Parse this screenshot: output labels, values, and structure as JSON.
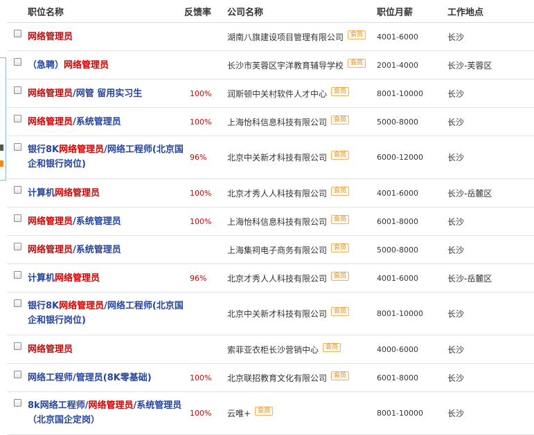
{
  "header": {
    "title": "职位名称",
    "feedback": "反馈率",
    "company": "公司名称",
    "salary": "职位月薪",
    "location": "工作地点"
  },
  "badge_label": "会员",
  "colors": {
    "keyword": "#d40000",
    "title": "#26449b",
    "badge": "#e0881d"
  },
  "rows": [
    {
      "title_parts": [
        {
          "t": "网络管理员",
          "kw": true
        }
      ],
      "feedback": "",
      "company": "湖南八旗建设项目管理有限公司",
      "salary": "4001-6000",
      "location": "长沙"
    },
    {
      "title_parts": [
        {
          "t": "（急聘）",
          "kw": false
        },
        {
          "t": "网络管理员",
          "kw": true
        }
      ],
      "feedback": "",
      "company": "长沙市芙蓉区宇洋教育辅导学校",
      "salary": "2001-4000",
      "location": "长沙-芙蓉区"
    },
    {
      "title_parts": [
        {
          "t": "网络管理员",
          "kw": true
        },
        {
          "t": "/网管  留用实习生",
          "kw": false
        }
      ],
      "feedback": "100%",
      "company": "润斯顿中关村软件人才中心",
      "salary": "8001-10000",
      "location": "长沙"
    },
    {
      "title_parts": [
        {
          "t": "网络管理员",
          "kw": true
        },
        {
          "t": "/系统管理员",
          "kw": false
        }
      ],
      "feedback": "100%",
      "company": "上海怡科信息科技有限公司",
      "salary": "5000-8000",
      "location": "长沙"
    },
    {
      "title_parts": [
        {
          "t": "银行8K",
          "kw": false
        },
        {
          "t": "网络管理员",
          "kw": true
        },
        {
          "t": "/网络工程师(北京国企和银行岗位)",
          "kw": false
        }
      ],
      "feedback": "96%",
      "company": "北京中关新才科技有限公司",
      "salary": "6000-12000",
      "location": "长沙"
    },
    {
      "title_parts": [
        {
          "t": "计算机",
          "kw": false
        },
        {
          "t": "网络管理员",
          "kw": true
        }
      ],
      "feedback": "100%",
      "company": "北京才秀人人科技有限公司",
      "salary": "4001-6000",
      "location": "长沙-岳麓区"
    },
    {
      "title_parts": [
        {
          "t": "网络管理员",
          "kw": true
        },
        {
          "t": "/系统管理员",
          "kw": false
        }
      ],
      "feedback": "100%",
      "company": "上海怡科信息科技有限公司",
      "salary": "6001-8000",
      "location": "长沙"
    },
    {
      "title_parts": [
        {
          "t": "网络管理员",
          "kw": true
        },
        {
          "t": "/系统管理员",
          "kw": false
        }
      ],
      "feedback": "",
      "company": "上海集祠电子商务有限公司",
      "salary": "5000-8000",
      "location": "长沙"
    },
    {
      "title_parts": [
        {
          "t": "计算机",
          "kw": false
        },
        {
          "t": "网络管理员",
          "kw": true
        }
      ],
      "feedback": "96%",
      "company": "北京才秀人人科技有限公司",
      "salary": "4001-6000",
      "location": "长沙-岳麓区"
    },
    {
      "title_parts": [
        {
          "t": "银行8K",
          "kw": false
        },
        {
          "t": "网络管理员",
          "kw": true
        },
        {
          "t": "/网络工程师(北京国企和银行岗位)",
          "kw": false
        }
      ],
      "feedback": "",
      "company": "北京中关新才科技有限公司",
      "salary": "8001-10000",
      "location": "长沙"
    },
    {
      "title_parts": [
        {
          "t": "网络管理员",
          "kw": true
        }
      ],
      "feedback": "",
      "company": "索菲亚衣柜长沙营销中心",
      "salary": "4000-6000",
      "location": "长沙"
    },
    {
      "title_parts": [
        {
          "t": "网络工程师/管理员(8K零基础)",
          "kw": false
        }
      ],
      "feedback": "100%",
      "company": "北京联招教育文化有限公司",
      "salary": "6001-8000",
      "location": "长沙"
    },
    {
      "title_parts": [
        {
          "t": "8k网络工程师/",
          "kw": false
        },
        {
          "t": "网络管理员",
          "kw": true
        },
        {
          "t": "/系统管理员（北京国企定岗）",
          "kw": false
        }
      ],
      "feedback": "100%",
      "company": "云唯+",
      "salary": "8001-10000",
      "location": "长沙"
    }
  ]
}
